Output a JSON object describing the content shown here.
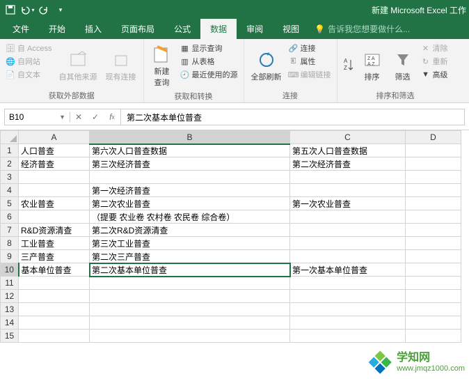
{
  "title": "新建 Microsoft Excel 工作",
  "qat": {
    "save": "保存",
    "undo": "撤销",
    "redo": "恢复"
  },
  "tabs": {
    "file": "文件",
    "home": "开始",
    "insert": "插入",
    "layout": "页面布局",
    "formulas": "公式",
    "data": "数据",
    "review": "审阅",
    "view": "视图"
  },
  "tell_me": "告诉我您想要做什么...",
  "ribbon": {
    "g1": {
      "access": "自 Access",
      "web": "自网站",
      "text": "自文本",
      "other": "自其他来源",
      "conn": "现有连接",
      "label": "获取外部数据"
    },
    "g2": {
      "newquery": "新建\n查询",
      "show": "显示查询",
      "from_table": "从表格",
      "recent": "最近使用的源",
      "label": "获取和转换"
    },
    "g3": {
      "refresh": "全部刷新",
      "conn": "连接",
      "prop": "属性",
      "edit": "编辑链接",
      "label": "连接"
    },
    "g4": {
      "sort": "排序",
      "filter": "筛选",
      "clear": "清除",
      "reapply": "重新",
      "adv": "高级",
      "label": "排序和筛选"
    }
  },
  "namebox": "B10",
  "formula": "第二次基本单位普查",
  "columns": [
    "A",
    "B",
    "C",
    "D"
  ],
  "cells": {
    "r1": {
      "A": "人口普查",
      "B": "第六次人口普查数据",
      "C": "第五次人口普查数据"
    },
    "r2": {
      "A": "经济普查",
      "B": "第三次经济普查",
      "C": "第二次经济普查"
    },
    "r3": {},
    "r4": {
      "B": "第一次经济普查"
    },
    "r5": {
      "A": "农业普查",
      "B": "第二次农业普查",
      "C": "第一次农业普查"
    },
    "r6": {
      "B": "（提要 农业卷 农村卷 农民卷 综合卷）"
    },
    "r7": {
      "A": "R&D资源清查",
      "B": "第二次R&D资源清查"
    },
    "r8": {
      "A": "工业普查",
      "B": "第三次工业普查"
    },
    "r9": {
      "A": "三产普查",
      "B": "第二次三产普查"
    },
    "r10": {
      "A": "基本单位普查",
      "B": "第二次基本单位普查",
      "C": "第一次基本单位普查"
    }
  },
  "watermark": {
    "line1": "学知网",
    "line2": "www.jmqz1000.com"
  }
}
